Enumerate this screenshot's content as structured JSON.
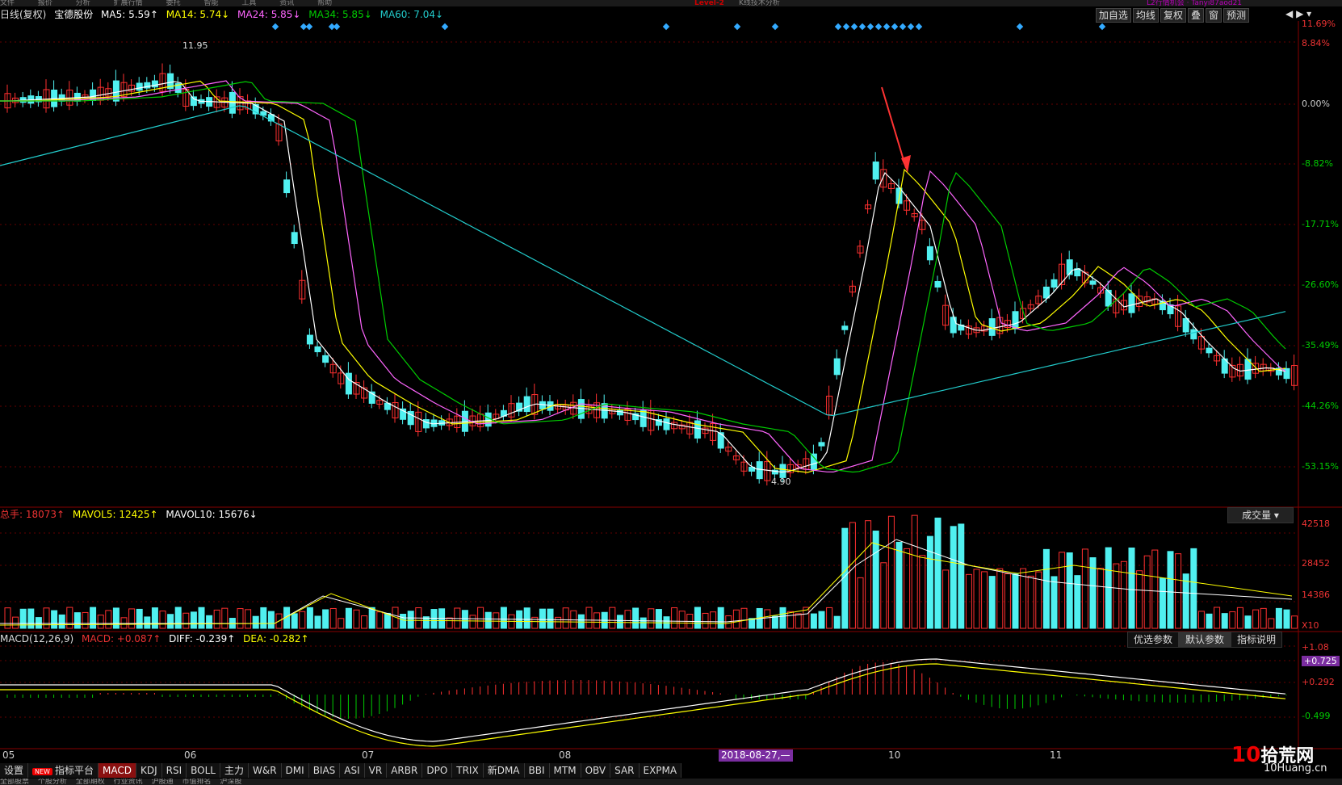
{
  "top_menu": [
    "文件",
    "报价",
    "分析",
    "扩展行情",
    "委托",
    "智能",
    "工具",
    "资讯",
    "帮助"
  ],
  "top_center_title": "Level-2",
  "top_subtitle": "K线技术分析",
  "top_right_text": "L2行情机会 · Tanyi87aod21",
  "header": {
    "period": "日线(复权)",
    "stock": "宝德股份",
    "ma5": "MA5: 5.59↑",
    "ma14": "MA14: 5.74↓",
    "ma24": "MA24: 5.85↓",
    "ma34": "MA34: 5.85↓",
    "ma60": "MA60: 7.04↓"
  },
  "colors": {
    "ma5": "#ffffff",
    "ma14": "#ffff00",
    "ma24": "#ff66ff",
    "ma34": "#00cc00",
    "ma60": "#22cccc",
    "up": "#ff3030",
    "down": "#50f0f0"
  },
  "right_buttons": [
    "加自选",
    "均线",
    "复权",
    "叠",
    "窗",
    "预测"
  ],
  "window_buttons": [
    "◀",
    "▶",
    "▾"
  ],
  "price_axis": [
    "11.69%",
    "8.84%",
    "0.00%",
    "-8.82%",
    "-17.71%",
    "-26.60%",
    "-35.49%",
    "-44.26%",
    "-53.15%"
  ],
  "annotations": {
    "high": "11.95",
    "low": "4.90"
  },
  "volume": {
    "header_total": "总手: 18073↑",
    "mavol5": "MAVOL5: 12425↑",
    "mavol10": "MAVOL10: 15676↓",
    "button": "成交量",
    "axis": [
      "42518",
      "28452",
      "14386",
      "X10"
    ]
  },
  "macd": {
    "title": "MACD(12,26,9)",
    "macd": "MACD: +0.087↑",
    "diff": "DIFF: -0.239↑",
    "dea": "DEA: -0.282↑",
    "buttons": [
      "优选参数",
      "默认参数",
      "指标说明"
    ],
    "axis": [
      "+1.08",
      "+0.725",
      "+0.292",
      "-0.499"
    ]
  },
  "time_axis": [
    "05",
    "06",
    "07",
    "08",
    "10",
    "11"
  ],
  "date_highlight": "2018-08-27,—",
  "tabs": [
    "设置",
    "指标平台",
    "MACD",
    "KDJ",
    "RSI",
    "BOLL",
    "主力",
    "W&R",
    "DMI",
    "BIAS",
    "ASI",
    "VR",
    "ARBR",
    "DPO",
    "TRIX",
    "新DMA",
    "BBI",
    "MTM",
    "OBV",
    "SAR",
    "EXPMA"
  ],
  "tab_new_badge": "NEW",
  "active_tab": "MACD",
  "bottom_row": [
    "全部股票",
    "个股分析",
    "全部期权",
    "行业资讯",
    "沪股通",
    "市值排名",
    "沪深股"
  ],
  "logo": {
    "num": "10",
    "text": "拾荒网",
    "sub": "10Huang.cn"
  }
}
